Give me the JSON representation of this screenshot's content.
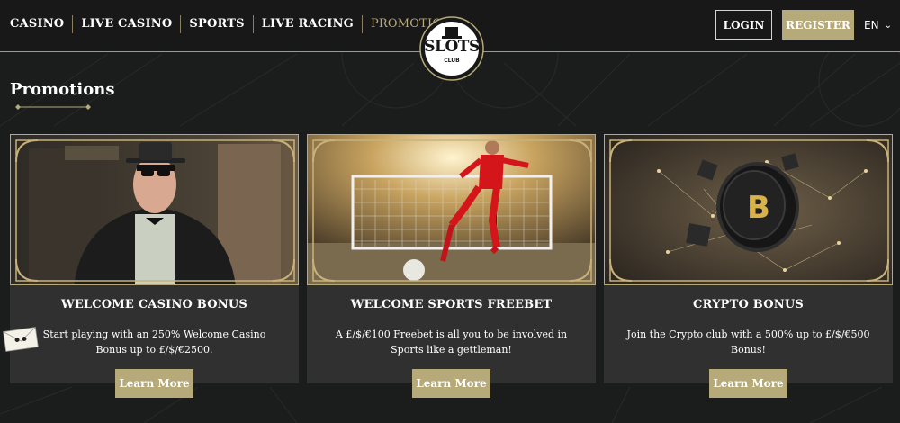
{
  "nav": {
    "items": [
      {
        "label": "CASINO"
      },
      {
        "label": "LIVE CASINO"
      },
      {
        "label": "SPORTS"
      },
      {
        "label": "LIVE RACING"
      },
      {
        "label": "PROMOTIONS"
      }
    ],
    "active": "PROMOTIONS"
  },
  "header": {
    "login_label": "LOGIN",
    "register_label": "REGISTER",
    "language": "EN",
    "logo_text": "SLOTS",
    "logo_sub": "CLUB"
  },
  "page": {
    "title": "Promotions"
  },
  "promotions": [
    {
      "title": "WELCOME CASINO BONUS",
      "description": "Start playing with an 250% Welcome Casino Bonus up to £/$/€2500.",
      "button": "Learn More",
      "image": "gangster-character"
    },
    {
      "title": "WELCOME SPORTS FREEBET",
      "description": "A £/$/€100 Freebet is all you to be involved in Sports like a gettleman!",
      "button": "Learn More",
      "image": "football-player"
    },
    {
      "title": "CRYPTO BONUS",
      "description": "Join the Crypto club with a 500% up to £/$/€500 Bonus!",
      "button": "Learn More",
      "image": "bitcoin-coin"
    }
  ],
  "colors": {
    "gold": "#b7aa7a",
    "background": "#1b1c1c",
    "card": "#303030",
    "header": "#181818"
  },
  "icons": {
    "language_chevron": "chevron-down-icon",
    "chat": "envelope-icon"
  }
}
